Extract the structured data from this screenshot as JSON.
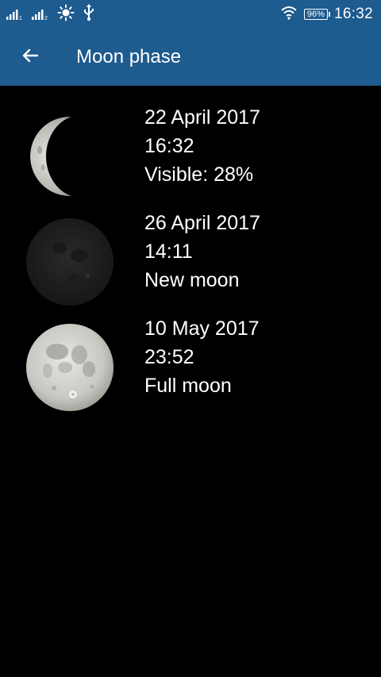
{
  "status_bar": {
    "signal1_icon": "signal-1-icon",
    "signal2_icon": "signal-2-icon",
    "brightness_icon": "brightness-icon",
    "usb_icon": "usb-icon",
    "wifi_icon": "wifi-icon",
    "battery": "96%",
    "time": "16:32"
  },
  "app_bar": {
    "back_icon": "arrow-back-icon",
    "title": "Moon phase",
    "color": "#1e5b8e"
  },
  "phases": [
    {
      "date": "22 April 2017",
      "time": "16:32",
      "label": "Visible: 28%",
      "illumination": 0.28,
      "icon": "waxing-crescent-moon-icon"
    },
    {
      "date": "26 April 2017",
      "time": "14:11",
      "label": "New moon",
      "illumination": 0.0,
      "icon": "new-moon-icon"
    },
    {
      "date": "10 May 2017",
      "time": "23:52",
      "label": "Full moon",
      "illumination": 1.0,
      "icon": "full-moon-icon"
    }
  ]
}
